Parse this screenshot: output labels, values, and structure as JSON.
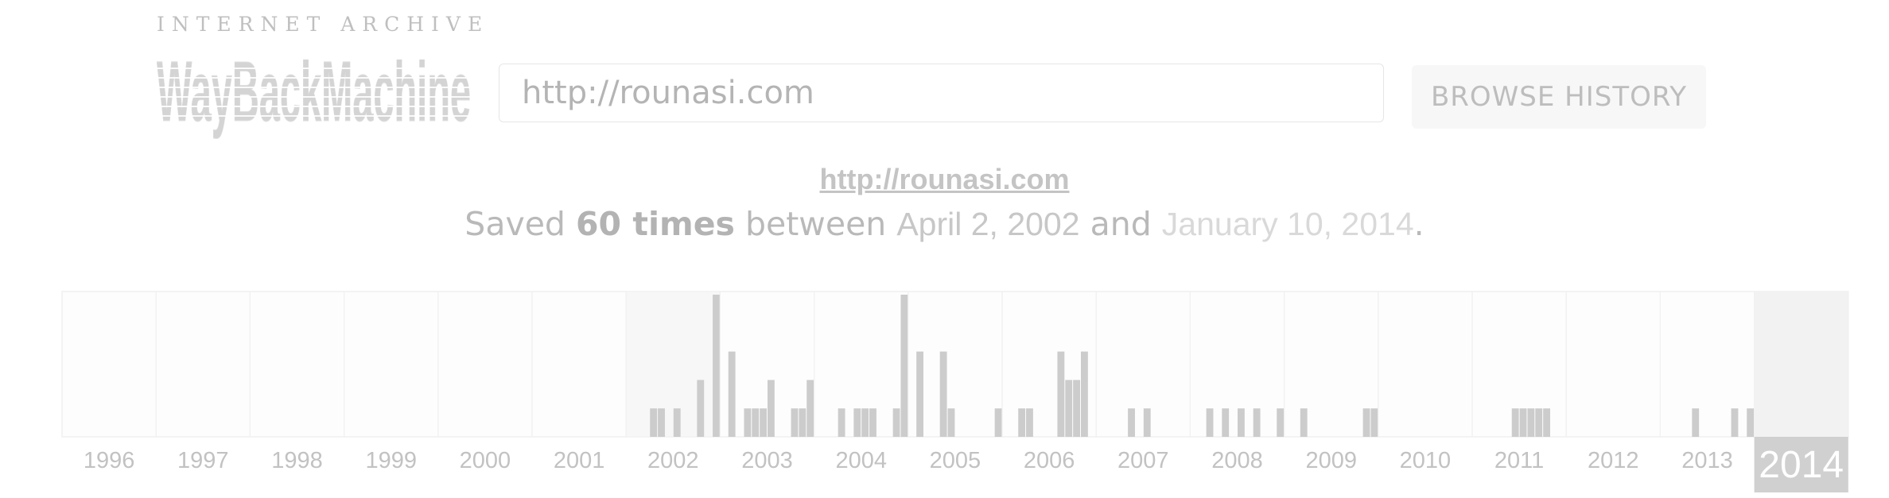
{
  "header": {
    "org_name": "INTERNET ARCHIVE",
    "logo_text": "WayBackMachine",
    "search_value": "http://rounasi.com",
    "browse_label": "BROWSE HISTORY"
  },
  "summary": {
    "url": "http://rounasi.com",
    "saved_prefix": "Saved",
    "saved_count": "60 times",
    "between_word": "between",
    "first_date": "April 2, 2002",
    "and_word": "and",
    "last_date": "January 10, 2014",
    "end_period": "."
  },
  "timeline": {
    "years": [
      "1996",
      "1997",
      "1998",
      "1999",
      "2000",
      "2001",
      "2002",
      "2003",
      "2004",
      "2005",
      "2006",
      "2007",
      "2008",
      "2009",
      "2010",
      "2011",
      "2012",
      "2013",
      "2014"
    ],
    "selected_year": "2014",
    "highlight_year": "2002",
    "bar_color": "#cccccc",
    "max_value": 5,
    "month_counts": {
      "2002": [
        0,
        0,
        0,
        1,
        1,
        0,
        1,
        0,
        0,
        2,
        0,
        5
      ],
      "2003": [
        0,
        3,
        0,
        1,
        1,
        1,
        2,
        0,
        0,
        1,
        1,
        2
      ],
      "2004": [
        0,
        0,
        0,
        1,
        0,
        1,
        1,
        1,
        0,
        0,
        1,
        5
      ],
      "2005": [
        0,
        3,
        0,
        0,
        3,
        1,
        0,
        0,
        0,
        0,
        0,
        1
      ],
      "2006": [
        0,
        0,
        1,
        1,
        0,
        0,
        0,
        3,
        2,
        2,
        3,
        0
      ],
      "2007": [
        0,
        0,
        0,
        0,
        1,
        0,
        1,
        0,
        0,
        0,
        0,
        0
      ],
      "2008": [
        0,
        0,
        1,
        0,
        1,
        0,
        1,
        0,
        1,
        0,
        0,
        1
      ],
      "2009": [
        0,
        0,
        1,
        0,
        0,
        0,
        0,
        0,
        0,
        0,
        1,
        1
      ],
      "2010": [
        0,
        0,
        0,
        0,
        0,
        0,
        0,
        0,
        0,
        0,
        0,
        0
      ],
      "2011": [
        0,
        0,
        0,
        0,
        0,
        1,
        1,
        1,
        1,
        1,
        0,
        0
      ],
      "2012": [
        0,
        0,
        0,
        0,
        0,
        0,
        0,
        0,
        0,
        0,
        0,
        0
      ],
      "2013": [
        0,
        0,
        0,
        0,
        1,
        0,
        0,
        0,
        0,
        1,
        0,
        1
      ],
      "2014": [
        0,
        0,
        0,
        0,
        0,
        0,
        0,
        0,
        0,
        0,
        0,
        0
      ]
    }
  }
}
